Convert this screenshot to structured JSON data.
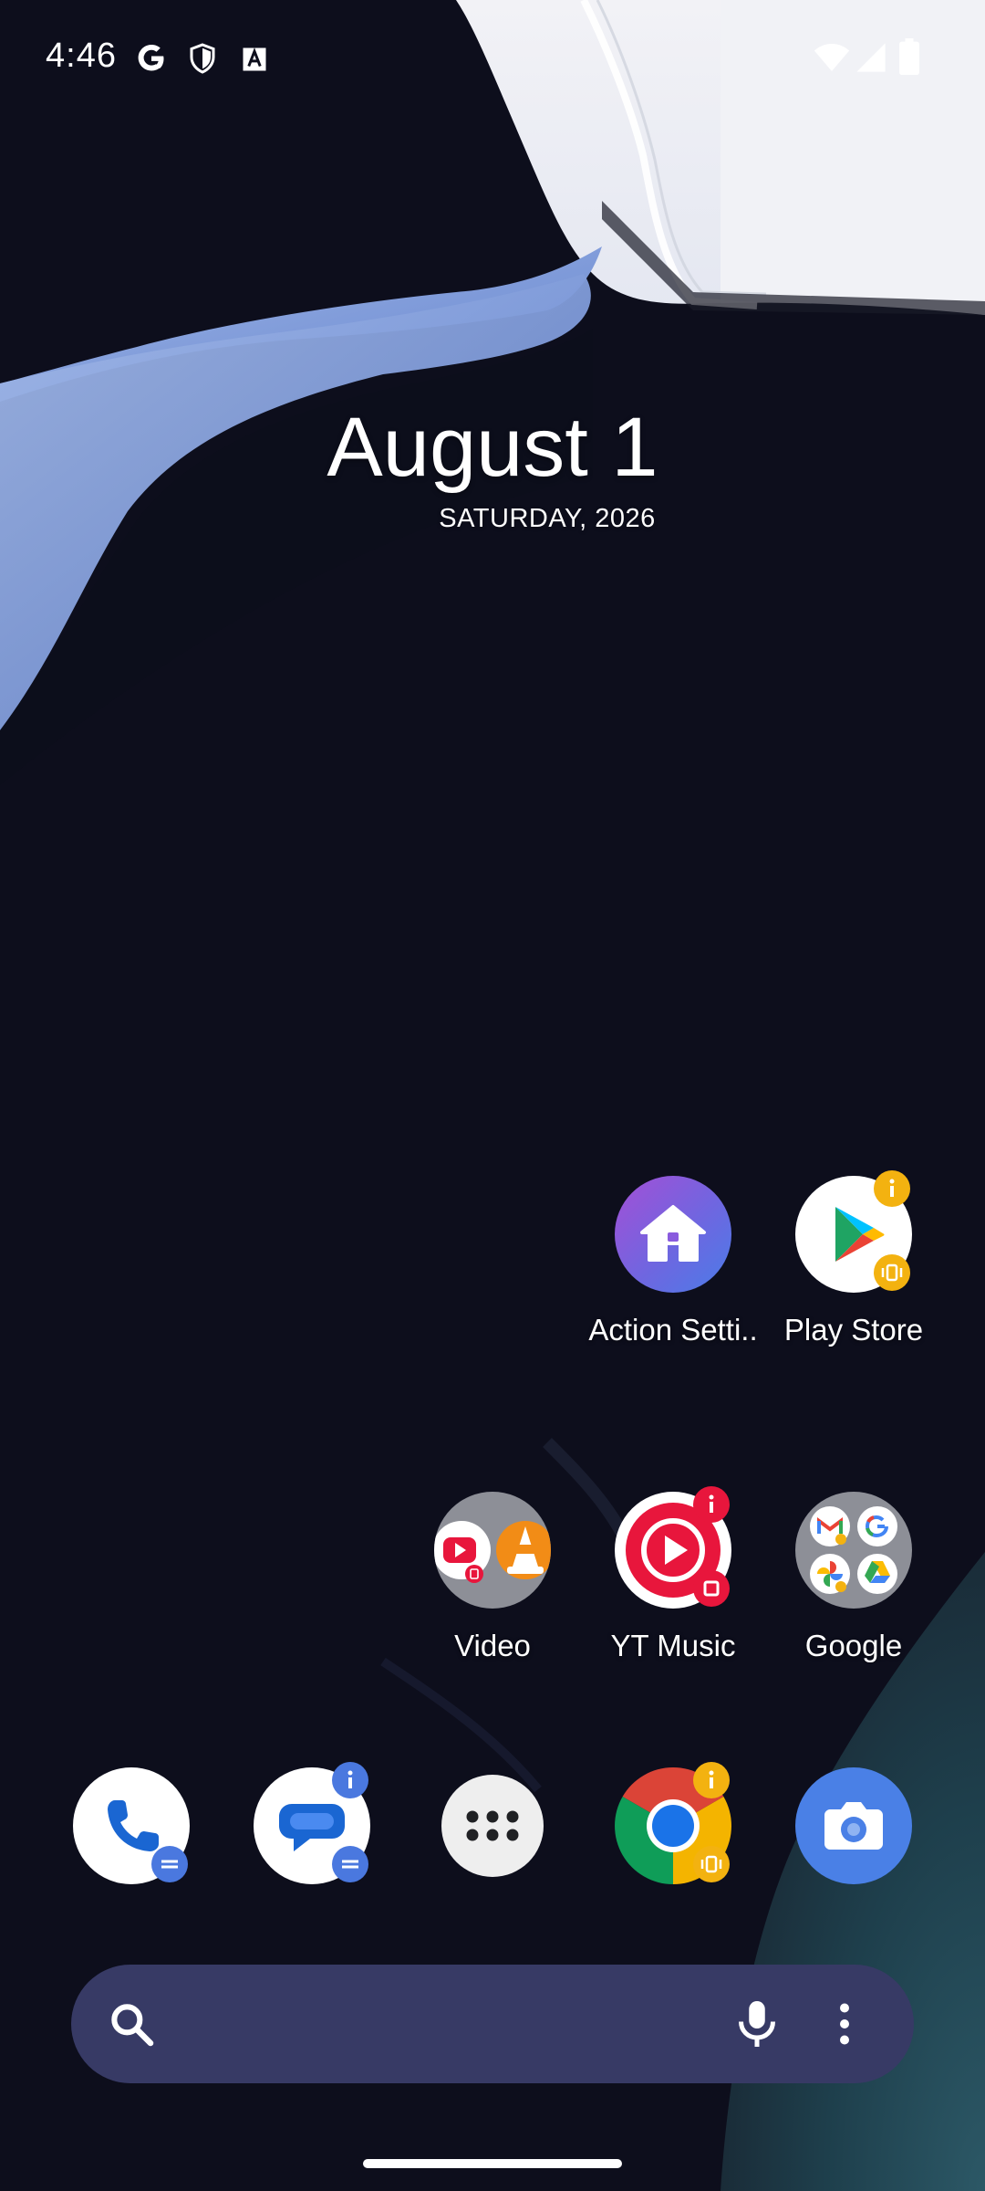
{
  "status_bar": {
    "time": "4:46",
    "left_icons": [
      "google-g-icon",
      "shield-icon",
      "font-a-icon"
    ],
    "right_icons": [
      "wifi-icon",
      "signal-icon",
      "battery-icon"
    ]
  },
  "clock_widget": {
    "date": "August 1",
    "day_year": "SATURDAY, 2026"
  },
  "home_apps": [
    {
      "label": "Action Setti..",
      "icon": "house-icon",
      "badges": []
    },
    {
      "label": "Play Store",
      "icon": "play-store-icon",
      "badges": [
        "info-badge",
        "vibrate-badge"
      ]
    },
    {
      "label": "Video",
      "icon": "video-folder-icon",
      "badges": []
    },
    {
      "label": "YT Music",
      "icon": "yt-music-icon",
      "badges": [
        "info-badge",
        "square-badge"
      ]
    },
    {
      "label": "Google",
      "icon": "google-folder-icon",
      "badges": []
    }
  ],
  "dock": [
    {
      "name": "phone",
      "icon": "phone-icon",
      "badges": [
        "menu-badge"
      ]
    },
    {
      "name": "messages",
      "icon": "messages-icon",
      "badges": [
        "info-badge",
        "menu-badge"
      ]
    },
    {
      "name": "app-drawer",
      "icon": "app-drawer-icon",
      "badges": []
    },
    {
      "name": "chrome",
      "icon": "chrome-icon",
      "badges": [
        "info-badge",
        "vibrate-badge"
      ]
    },
    {
      "name": "camera",
      "icon": "camera-icon",
      "badges": []
    }
  ],
  "search_bar": {
    "icons": [
      "search-icon",
      "mic-icon",
      "more-vert-icon"
    ]
  },
  "colors": {
    "background": "#0d0e1c",
    "search_bar": "#373a65",
    "badge_yellow": "#f3b210",
    "badge_red": "#e8163c",
    "badge_blue": "#4a78df"
  }
}
